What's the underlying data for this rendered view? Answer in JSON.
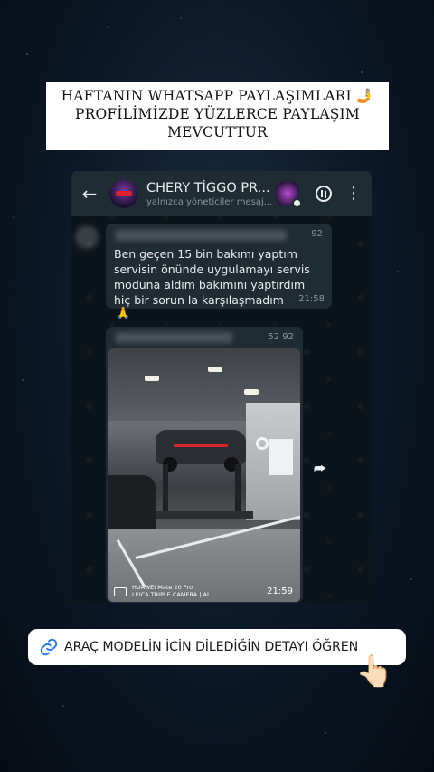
{
  "banner": {
    "line1": "HAFTANIN WHATSAPP PAYLAŞIMLARI 🤳",
    "line2": "PROFİLİMİZDE YÜZLERCE PAYLAŞIM",
    "line3": "MEVCUTTUR"
  },
  "chat": {
    "title": "CHERY TİGGO PR...",
    "subtitle": "yalnızca yöneticiler mesaj...",
    "icons": {
      "back": "←",
      "menu": "⋮",
      "share": "⮫"
    },
    "messages": [
      {
        "sender_tag": "92",
        "text": "Ben geçen 15 bin bakımı yaptım servisin önünde uygulamayı servis moduna aldım bakımını yaptırdım hiç bir sorun la karşılaşmadım",
        "time": "21:58",
        "reaction": "🙏"
      },
      {
        "sender_tag": "52 92",
        "camera_line1": "HUAWEI Mate 20 Pro",
        "camera_line2": "LEICA TRIPLE CAMERA | AI",
        "time": "21:59"
      }
    ]
  },
  "cta": {
    "label": "ARAÇ MODELİN İÇİN DİLEDİĞİN DETAYI ÖĞREN",
    "pointer": "👆🏻"
  },
  "colors": {
    "whatsapp_bg": "#0b141a",
    "header_bg": "#1f2c34",
    "bubble_bg": "#202c33",
    "link_blue": "#2d7fe6"
  }
}
